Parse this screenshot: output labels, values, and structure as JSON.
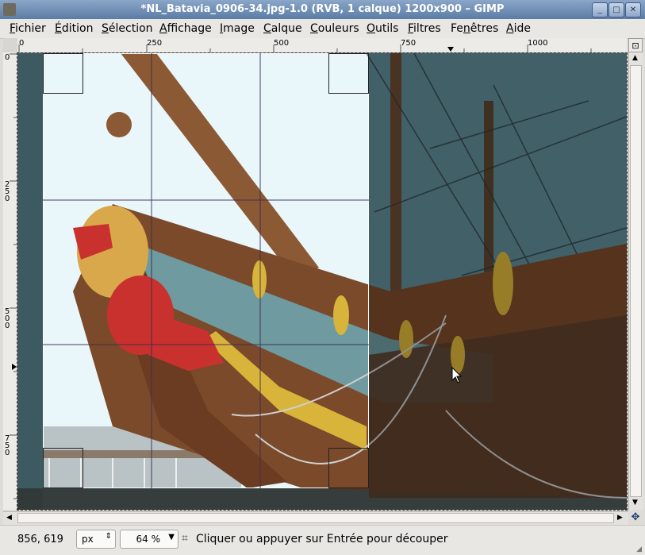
{
  "window": {
    "title": "*NL_Batavia_0906-34.jpg-1.0 (RVB, 1 calque) 1200x900 – GIMP",
    "minimize_glyph": "_",
    "maximize_glyph": "□",
    "close_glyph": "✕"
  },
  "menubar": {
    "items": [
      {
        "label": "Fichier",
        "accel": "F"
      },
      {
        "label": "Édition",
        "accel": "É"
      },
      {
        "label": "Sélection",
        "accel": "S"
      },
      {
        "label": "Affichage",
        "accel": "A"
      },
      {
        "label": "Image",
        "accel": "I"
      },
      {
        "label": "Calque",
        "accel": "C"
      },
      {
        "label": "Couleurs",
        "accel": "C"
      },
      {
        "label": "Outils",
        "accel": "O"
      },
      {
        "label": "Filtres",
        "accel": "F"
      },
      {
        "label": "Fenêtres",
        "accel": "n"
      },
      {
        "label": "Aide",
        "accel": "A"
      }
    ]
  },
  "rulers": {
    "top_labels": [
      "0",
      "250",
      "500",
      "750",
      "1000"
    ],
    "left_labels": [
      "0",
      "250",
      "500",
      "750"
    ]
  },
  "statusbar": {
    "coordinates": "856, 619",
    "unit": "px",
    "zoom": "64 %",
    "message": "Cliquer ou appuyer sur Entrée pour découper"
  },
  "icons": {
    "crop_tool": "crop-icon",
    "navigate": "navigate-icon"
  },
  "colors": {
    "titlebar": "#6f8db6",
    "sky": "#e9f7fb",
    "hull_blue": "#6e9aa0",
    "hull_brown": "#7a4a2a",
    "lion_red": "#c9312f",
    "gold": "#d8b43a"
  }
}
